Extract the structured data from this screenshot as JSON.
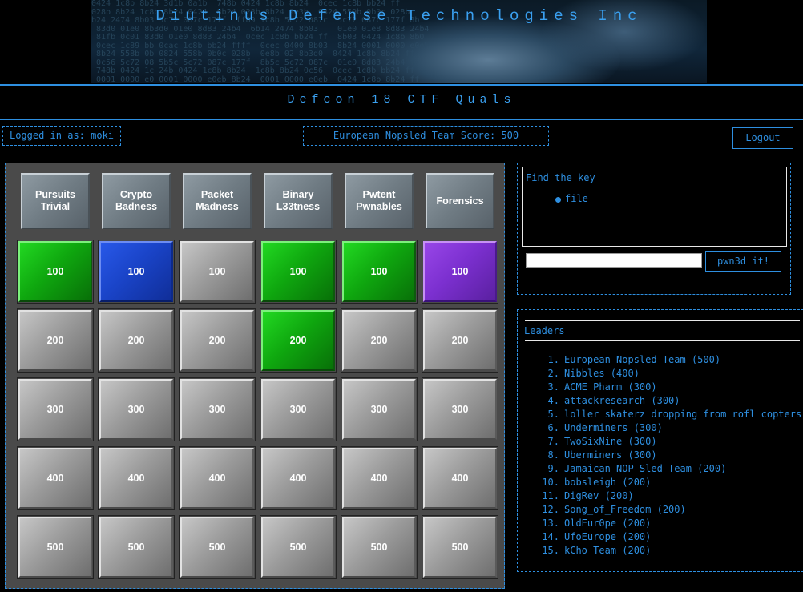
{
  "site": {
    "title": "Diutinus Defense Technologies Inc",
    "subtitle": "Defcon 18 CTF Quals"
  },
  "status": {
    "logged_in": "Logged in as: moki",
    "score": "European Nopsled Team Score: 500",
    "logout_label": "Logout"
  },
  "board": {
    "categories": [
      "Pursuits Trivial",
      "Crypto Badness",
      "Packet Madness",
      "Binary L33tness",
      "Pwtent Pwnables",
      "Forensics"
    ],
    "rows": [
      {
        "value": "100",
        "colors": [
          "green",
          "blue",
          "gray",
          "green",
          "green",
          "purple"
        ]
      },
      {
        "value": "200",
        "colors": [
          "gray",
          "gray",
          "gray",
          "green",
          "gray",
          "gray"
        ]
      },
      {
        "value": "300",
        "colors": [
          "gray",
          "gray",
          "gray",
          "gray",
          "gray",
          "gray"
        ]
      },
      {
        "value": "400",
        "colors": [
          "gray",
          "gray",
          "gray",
          "gray",
          "gray",
          "gray"
        ]
      },
      {
        "value": "500",
        "colors": [
          "gray",
          "gray",
          "gray",
          "gray",
          "gray",
          "gray"
        ]
      }
    ]
  },
  "challenge": {
    "title": "Find the key",
    "link": "file",
    "input_value": "",
    "submit_label": "pwn3d it!"
  },
  "leaders": {
    "title": "Leaders",
    "entries": [
      {
        "rank": "1.",
        "name": "European Nopsled Team (500)"
      },
      {
        "rank": "2.",
        "name": "Nibbles (400)"
      },
      {
        "rank": "3.",
        "name": "ACME Pharm (300)"
      },
      {
        "rank": "4.",
        "name": "attackresearch (300)"
      },
      {
        "rank": "5.",
        "name": "loller skaterz dropping from rofl copters!"
      },
      {
        "rank": "6.",
        "name": "Underminers (300)"
      },
      {
        "rank": "7.",
        "name": "TwoSixNine (300)"
      },
      {
        "rank": "8.",
        "name": "Uberminers (300)"
      },
      {
        "rank": "9.",
        "name": "Jamaican NOP Sled Team (200)"
      },
      {
        "rank": "10.",
        "name": "bobsleigh (200)"
      },
      {
        "rank": "11.",
        "name": "DigRev (200)"
      },
      {
        "rank": "12.",
        "name": "Song_of_Freedom (200)"
      },
      {
        "rank": "13.",
        "name": "OldEur0pe (200)"
      },
      {
        "rank": "14.",
        "name": "UfoEurope (200)"
      },
      {
        "rank": "15.",
        "name": "kCho Team (200)"
      }
    ]
  },
  "colors": {
    "accent": "#2e8fe0",
    "background": "#000000",
    "board_background": "#4a4a4a",
    "tile_green": "#12b812",
    "tile_blue": "#1a44c8",
    "tile_purple": "#7c30d0",
    "tile_gray": "#9c9c9c"
  }
}
